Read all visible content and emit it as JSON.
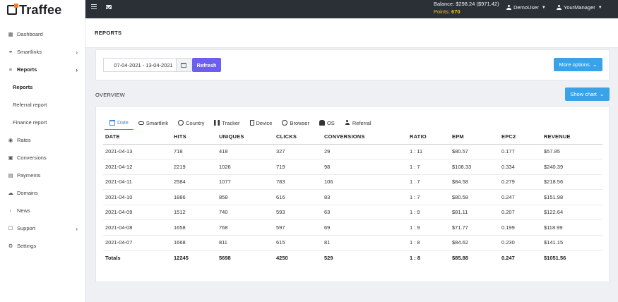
{
  "brand": {
    "logo_text": "Traffee"
  },
  "topbar": {
    "balance": "Balance: $298.24 ($971.42)",
    "points_label": "Points:",
    "points_value": "670",
    "user1": "DemoUser",
    "user2": "YourManager"
  },
  "sidebar": {
    "items": [
      {
        "label": "Dashboard",
        "icon": "dashboard-icon"
      },
      {
        "label": "Smartlinks",
        "icon": "link-icon",
        "has_submenu": true
      },
      {
        "label": "Reports",
        "icon": "reports-icon",
        "has_submenu": true,
        "active": true
      },
      {
        "label": "Rates",
        "icon": "globe-icon"
      },
      {
        "label": "Conversions",
        "icon": "conversions-icon"
      },
      {
        "label": "Payments",
        "icon": "card-icon"
      },
      {
        "label": "Domains",
        "icon": "cloud-icon"
      },
      {
        "label": "News",
        "icon": "news-icon"
      },
      {
        "label": "Support",
        "icon": "support-icon",
        "has_submenu": true
      },
      {
        "label": "Settings",
        "icon": "gear-icon"
      }
    ],
    "sub_items": [
      "Reports",
      "Referral report",
      "Finance report"
    ]
  },
  "page": {
    "title": "REPORTS"
  },
  "filters": {
    "date_range": "07-04-2021 - 13-04-2021",
    "refresh_label": "Refresh",
    "more_options_label": "More options"
  },
  "overview": {
    "label": "OVERVIEW",
    "show_chart_label": "Show chart"
  },
  "tabs": [
    "Date",
    "Smartlink",
    "Country",
    "Tracker",
    "Device",
    "Browser",
    "OS",
    "Referral"
  ],
  "table": {
    "headers": [
      "DATE",
      "HITS",
      "UNIQUES",
      "CLICKS",
      "CONVERSIONS",
      "RATIO",
      "EPM",
      "EPC2",
      "REVENUE"
    ],
    "rows": [
      [
        "2021-04-13",
        "718",
        "418",
        "327",
        "29",
        "1 : 11",
        "$80.57",
        "0.177",
        "$57.85"
      ],
      [
        "2021-04-12",
        "2219",
        "1026",
        "719",
        "98",
        "1 : 7",
        "$108.33",
        "0.334",
        "$240.39"
      ],
      [
        "2021-04-11",
        "2584",
        "1077",
        "783",
        "106",
        "1 : 7",
        "$84.58",
        "0.279",
        "$218.56"
      ],
      [
        "2021-04-10",
        "1886",
        "858",
        "616",
        "83",
        "1 : 7",
        "$80.58",
        "0.247",
        "$151.98"
      ],
      [
        "2021-04-09",
        "1512",
        "740",
        "593",
        "63",
        "1 : 9",
        "$81.11",
        "0.207",
        "$122.64"
      ],
      [
        "2021-04-08",
        "1658",
        "768",
        "597",
        "69",
        "1 : 9",
        "$71.77",
        "0.199",
        "$118.99"
      ],
      [
        "2021-04-07",
        "1668",
        "811",
        "615",
        "81",
        "1 : 8",
        "$84.62",
        "0.230",
        "$141.15"
      ]
    ],
    "totals": [
      "Totals",
      "12245",
      "5698",
      "4250",
      "529",
      "1 : 8",
      "$85.88",
      "0.247",
      "$1051.56"
    ]
  }
}
